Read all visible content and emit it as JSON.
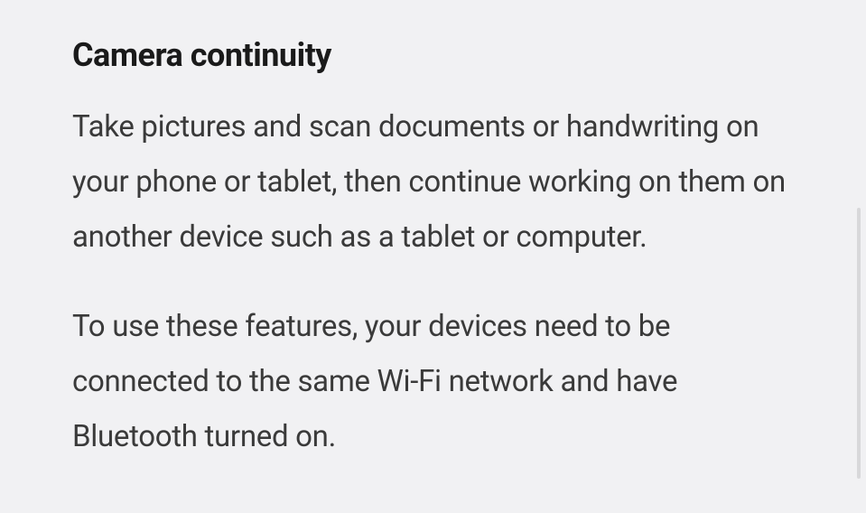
{
  "section": {
    "heading": "Camera continuity",
    "paragraph1": "Take pictures and scan documents or handwriting on your phone or tablet, then continue working on them on another device such as a tablet or computer.",
    "paragraph2": "To use these features, your devices need to be connected to the same Wi-Fi network and have Bluetooth turned on."
  }
}
